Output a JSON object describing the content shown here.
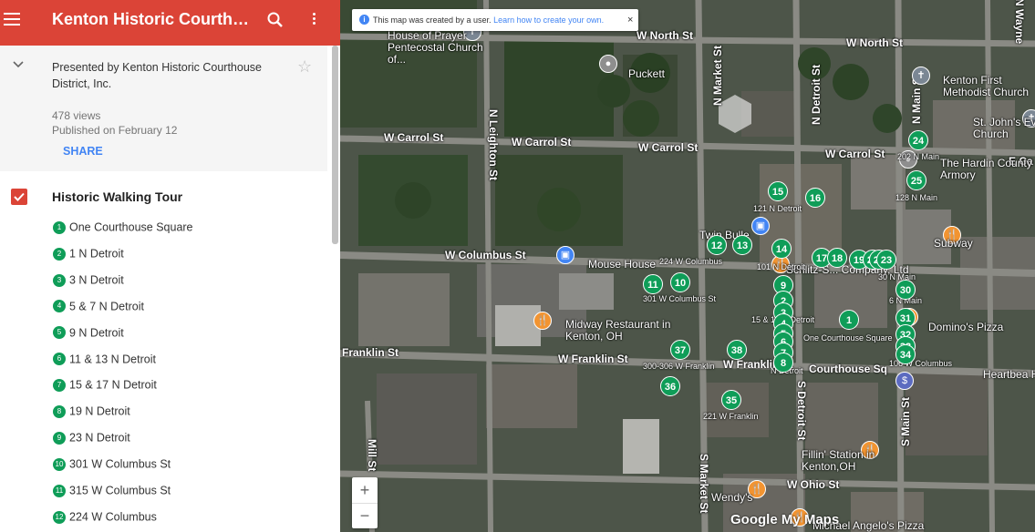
{
  "header": {
    "title": "Kenton Historic Courthou..."
  },
  "info": {
    "presented_by": "Presented by Kenton Historic Courthouse District, Inc.",
    "views": "478 views",
    "published": "Published on February 12",
    "share_label": "SHARE"
  },
  "layer": {
    "title": "Historic Walking Tour",
    "items": [
      {
        "num": "1",
        "label": "One Courthouse Square"
      },
      {
        "num": "2",
        "label": "1 N Detroit"
      },
      {
        "num": "3",
        "label": "3 N Detroit"
      },
      {
        "num": "4",
        "label": "5 & 7 N Detroit"
      },
      {
        "num": "5",
        "label": "9 N Detroit"
      },
      {
        "num": "6",
        "label": "11 & 13 N Detroit"
      },
      {
        "num": "7",
        "label": "15 & 17 N Detroit"
      },
      {
        "num": "8",
        "label": "19 N Detroit"
      },
      {
        "num": "9",
        "label": "23 N Detroit"
      },
      {
        "num": "10",
        "label": "301 W Columbus St"
      },
      {
        "num": "11",
        "label": "315 W Columbus St"
      },
      {
        "num": "12",
        "label": "224 W Columbus"
      }
    ]
  },
  "map": {
    "notice_text": "This map was created by a user.",
    "notice_link": "Learn how to create your own.",
    "notice_close": "×",
    "zoom_in": "+",
    "zoom_out": "−",
    "logo": "Google My Maps",
    "roads": [
      {
        "name": "W North St",
        "orient": "h"
      },
      {
        "name": "W North St",
        "orient": "h"
      },
      {
        "name": "W Carrol St",
        "orient": "h"
      },
      {
        "name": "W Carrol St",
        "orient": "h"
      },
      {
        "name": "W Carrol St",
        "orient": "h"
      },
      {
        "name": "W Carrol St",
        "orient": "h"
      },
      {
        "name": "W Columbus St",
        "orient": "h"
      },
      {
        "name": "Franklin St",
        "orient": "h"
      },
      {
        "name": "W Franklin St",
        "orient": "h"
      },
      {
        "name": "W Franklin St",
        "orient": "h"
      },
      {
        "name": "Courthouse Sq",
        "orient": "h"
      },
      {
        "name": "W Ohio St",
        "orient": "h"
      },
      {
        "name": "N Leighton St",
        "orient": "v"
      },
      {
        "name": "N Market St",
        "orient": "vn"
      },
      {
        "name": "N Detroit St",
        "orient": "vn"
      },
      {
        "name": "N Main St",
        "orient": "vn"
      },
      {
        "name": "N Wayne",
        "orient": "v"
      },
      {
        "name": "S Market St",
        "orient": "v"
      },
      {
        "name": "S Detroit St",
        "orient": "v"
      },
      {
        "name": "S Main St",
        "orient": "vn"
      },
      {
        "name": "Mill St",
        "orient": "v"
      },
      {
        "name": "E Ca",
        "orient": "h"
      }
    ],
    "places": [
      {
        "name": "House of Prayer Pentecostal Church of...",
        "icon": "cross-icon"
      },
      {
        "name": "Puckett",
        "icon": "pin-icon"
      },
      {
        "name": "Kenton First Methodist Church",
        "icon": "cross-icon"
      },
      {
        "name": "St. John's Evangelical Church",
        "icon": "cross-icon"
      },
      {
        "name": "The Hardin County Armory",
        "icon": "pin-icon"
      },
      {
        "name": "Subway",
        "icon": "restaurant-icon"
      },
      {
        "name": "Mouse House",
        "icon": "lock-icon"
      },
      {
        "name": "Midway Restaurant in Kenton, OH",
        "icon": "restaurant-icon"
      },
      {
        "name": "Domino's Pizza",
        "icon": "restaurant-icon"
      },
      {
        "name": "Heartbea Hardin Cou",
        "icon": "bank-icon"
      },
      {
        "name": "Fillin' Station in Kenton,OH",
        "icon": "restaurant-icon"
      },
      {
        "name": "Wendy's",
        "icon": "restaurant-icon"
      },
      {
        "name": "Michael Angelo's Pizza",
        "icon": "restaurant-icon"
      },
      {
        "name": "Twin Bulle",
        "icon": "lock-icon"
      },
      {
        "name": "Schlitz-S... Company, Ltd",
        "icon": "restaurant-icon"
      }
    ],
    "small_labels": [
      "121 N Detroit",
      "101 N Detroit",
      "224 W Columbus",
      "301 W Columbus St",
      "15 & 17 N Detroit",
      "One Courthouse Square",
      "300-306 W Franklin",
      "221 W Franklin",
      "N Detroit",
      "202 N Main",
      "128 N Main",
      "30 N Main",
      "6 N Main",
      "106 W Columbus"
    ],
    "markers": [
      "24",
      "25",
      "15",
      "16",
      "12",
      "13",
      "14",
      "9",
      "11",
      "10",
      "17",
      "18",
      "19",
      "21",
      "22",
      "23",
      "1",
      "30",
      "31",
      "32",
      "33",
      "34",
      "37",
      "38",
      "36",
      "35",
      "2",
      "3",
      "4",
      "5",
      "6",
      "7",
      "8"
    ]
  },
  "colors": {
    "header": "#db4437",
    "marker": "#0f9d58",
    "link": "#4285f4"
  }
}
